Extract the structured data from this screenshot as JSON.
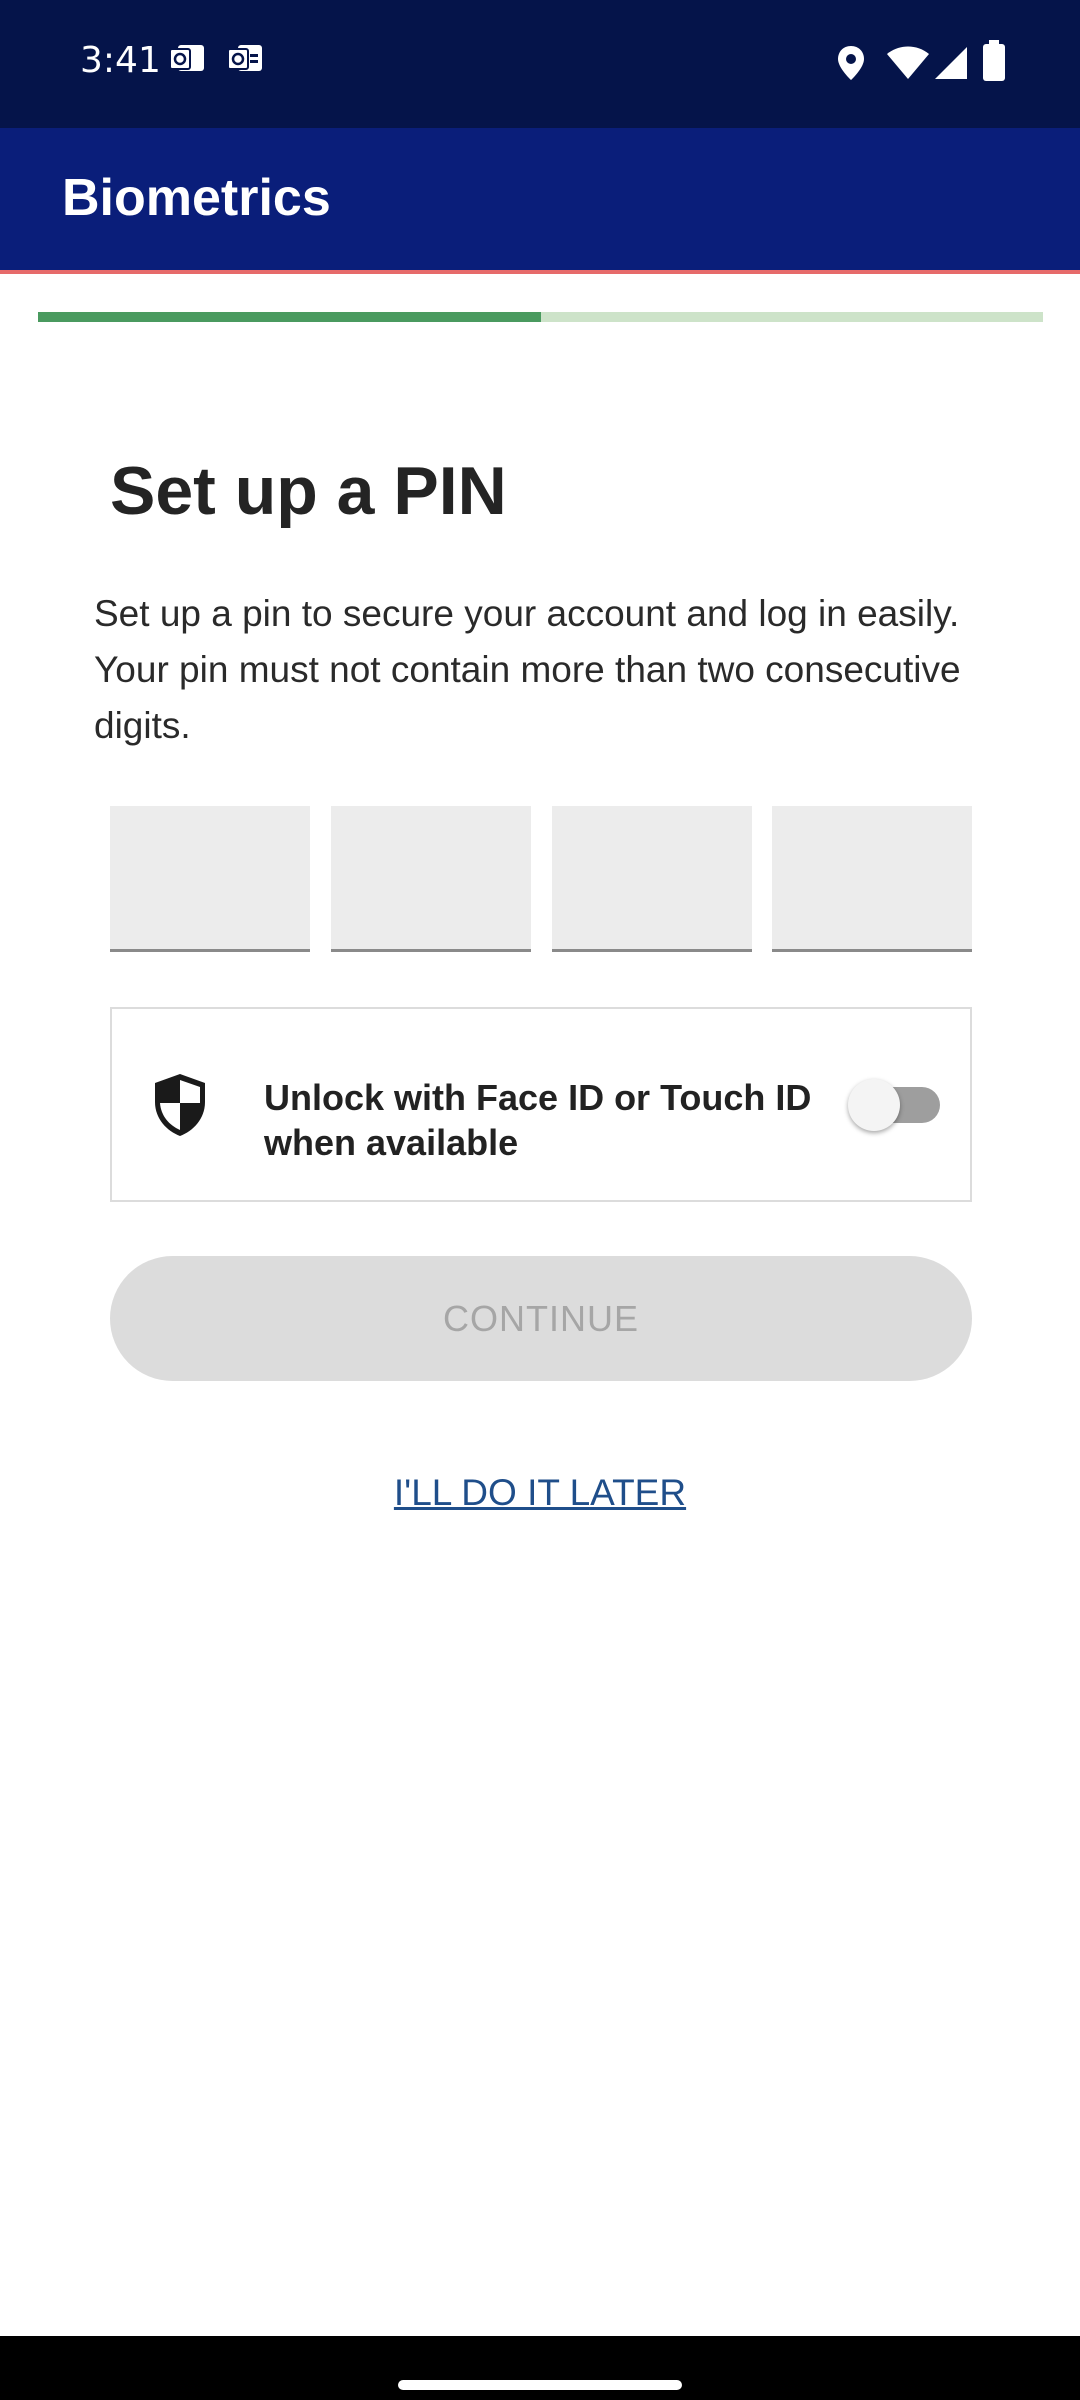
{
  "status_bar": {
    "time": "3:41",
    "left_icons": [
      "outlook-icon",
      "outlook-calendar-icon"
    ],
    "right_icons": [
      "location-icon",
      "wifi-icon",
      "signal-icon",
      "battery-icon"
    ]
  },
  "app_bar": {
    "title": "Biometrics",
    "background": "#0a1e7a"
  },
  "progress": {
    "value": 0.5,
    "fill_color": "#4a9a5f",
    "track_color": "#cde3c9"
  },
  "main": {
    "heading": "Set up a PIN",
    "description": "Set up a pin to secure your account and log in easily. Your pin must not contain more than two consecutive digits.",
    "pin_fields": [
      "",
      "",
      "",
      ""
    ],
    "biometrics": {
      "icon": "shield-icon",
      "label": "Unlock with Face ID or Touch ID when available",
      "enabled": false
    },
    "continue_label": "CONTINUE",
    "later_label": "I'LL DO IT LATER"
  }
}
